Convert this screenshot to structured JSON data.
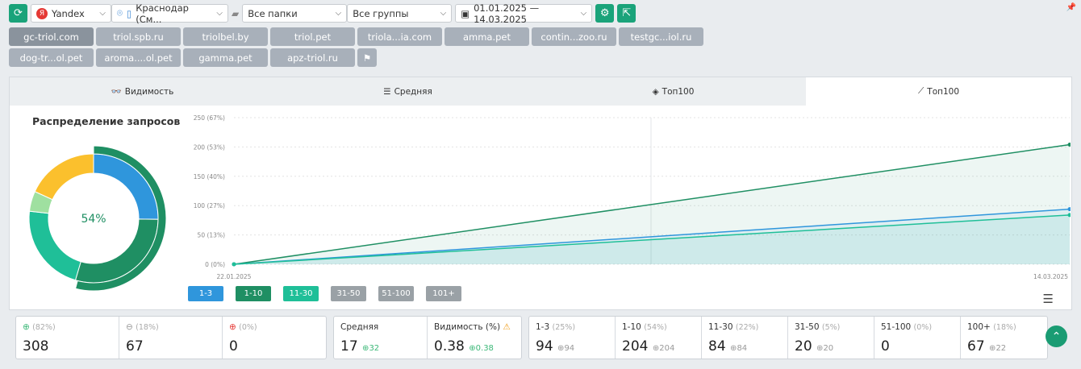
{
  "toolbar": {
    "engine": "Yandex",
    "region": "Краснодар (См...",
    "folders": "Все папки",
    "groups": "Все группы",
    "date_range": "01.01.2025 — 14.03.2025"
  },
  "sites": [
    "gc-triol.com",
    "triol.spb.ru",
    "triolbel.by",
    "triol.pet",
    "triola...ia.com",
    "amma.pet",
    "contin...zoo.ru",
    "testgc...iol.ru",
    "dog-tr...ol.pet",
    "aroma....ol.pet",
    "gamma.pet",
    "apz-triol.ru"
  ],
  "tabs": [
    "Видимость",
    "Средняя",
    "Топ100",
    "Топ100"
  ],
  "donut": {
    "title": "Распределение запросов",
    "center": "54%",
    "segments": [
      {
        "label": "1-3",
        "pct": 25,
        "color": "#2f96dc"
      },
      {
        "label": "1-10",
        "pct": 29,
        "color": "#1f8f63"
      },
      {
        "label": "11-30",
        "pct": 22,
        "color": "#1fbf98"
      },
      {
        "label": "31-50",
        "pct": 5,
        "color": "#9fe0a0"
      },
      {
        "label": "100+",
        "pct": 18,
        "color": "#fbc02d"
      }
    ],
    "outer": {
      "label": "1-10",
      "pct": 54,
      "color": "#1f8f63"
    }
  },
  "chart_data": {
    "type": "line",
    "x": [
      "22.01.2025",
      "14.03.2025"
    ],
    "ylim": [
      0,
      250
    ],
    "yticks": [
      "0 (0%)",
      "50 (13%)",
      "100 (27%)",
      "150 (40%)",
      "200 (53%)",
      "250 (67%)"
    ],
    "series": [
      {
        "name": "1-10",
        "values": [
          0,
          204
        ],
        "color": "#1f8f63"
      },
      {
        "name": "1-3",
        "values": [
          0,
          94
        ],
        "color": "#2f96dc"
      },
      {
        "name": "11-30",
        "values": [
          0,
          84
        ],
        "color": "#1fbf98"
      }
    ],
    "legend": [
      {
        "name": "1-3",
        "color": "#2f96dc"
      },
      {
        "name": "1-10",
        "color": "#1f8f63"
      },
      {
        "name": "11-30",
        "color": "#1fbf98"
      },
      {
        "name": "31-50",
        "color": "#9aa1a6"
      },
      {
        "name": "51-100",
        "color": "#9aa1a6"
      },
      {
        "name": "101+",
        "color": "#9aa1a6"
      }
    ]
  },
  "stats": {
    "g1": [
      {
        "pct": "(82%)",
        "val": "308",
        "icon": "up-circle",
        "color": "#3cb878"
      },
      {
        "pct": "(18%)",
        "val": "67",
        "icon": "minus-circle",
        "color": "#999"
      },
      {
        "pct": "(0%)",
        "val": "0",
        "icon": "down-circle",
        "color": "#e53935"
      }
    ],
    "g2": [
      {
        "label": "Средняя",
        "val": "17",
        "delta": "32"
      },
      {
        "label": "Видимость (%)",
        "val": "0.38",
        "delta": "0.38"
      }
    ],
    "g3": [
      {
        "label": "1-3",
        "pct": "(25%)",
        "val": "94",
        "delta": "94"
      },
      {
        "label": "1-10",
        "pct": "(54%)",
        "val": "204",
        "delta": "204"
      },
      {
        "label": "11-30",
        "pct": "(22%)",
        "val": "84",
        "delta": "84"
      },
      {
        "label": "31-50",
        "pct": "(5%)",
        "val": "20",
        "delta": "20"
      },
      {
        "label": "51-100",
        "pct": "(0%)",
        "val": "0",
        "delta": ""
      },
      {
        "label": "100+",
        "pct": "(18%)",
        "val": "67",
        "delta": "22"
      }
    ]
  }
}
